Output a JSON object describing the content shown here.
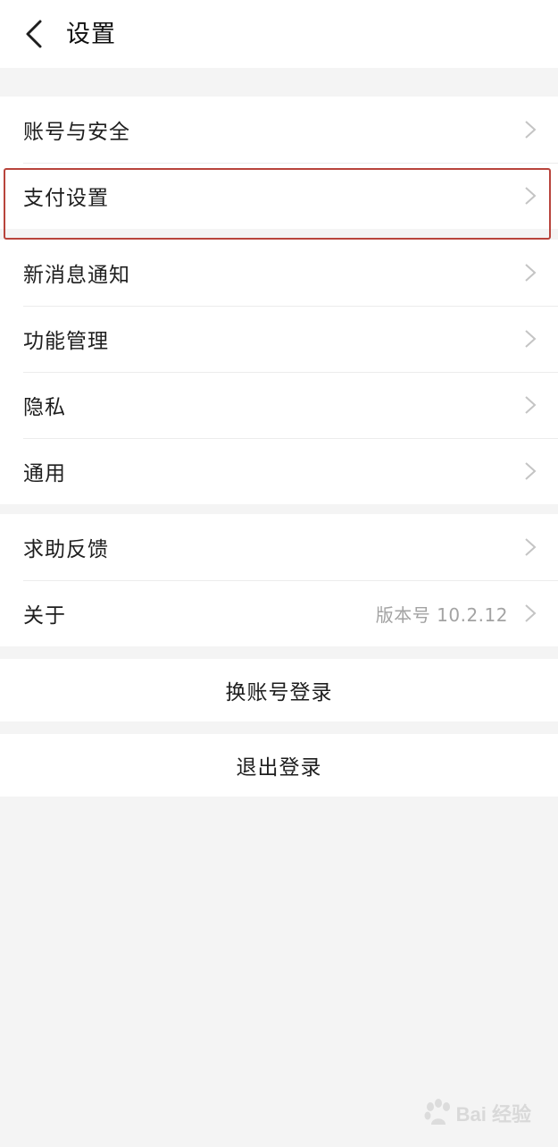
{
  "header": {
    "title": "设置",
    "back_icon": "chevron-left-icon"
  },
  "groups": {
    "account": {
      "label": "账号与安全"
    },
    "payment": {
      "label": "支付设置"
    },
    "notifications": {
      "label": "新消息通知"
    },
    "features": {
      "label": "功能管理"
    },
    "privacy": {
      "label": "隐私"
    },
    "general": {
      "label": "通用"
    },
    "feedback": {
      "label": "求助反馈"
    },
    "about": {
      "label": "关于",
      "value": "版本号 10.2.12"
    }
  },
  "actions": {
    "switch_account": "换账号登录",
    "logout": "退出登录"
  },
  "annotation": {
    "highlight_color": "#b8443c",
    "highlighted_item": "支付设置"
  },
  "watermark": {
    "text": "Bai  经验",
    "icon": "baidu-paw-icon"
  },
  "colors": {
    "background": "#f4f4f4",
    "surface": "#ffffff",
    "chevron": "#c4c4c4",
    "secondary_text": "#a3a3a3"
  }
}
